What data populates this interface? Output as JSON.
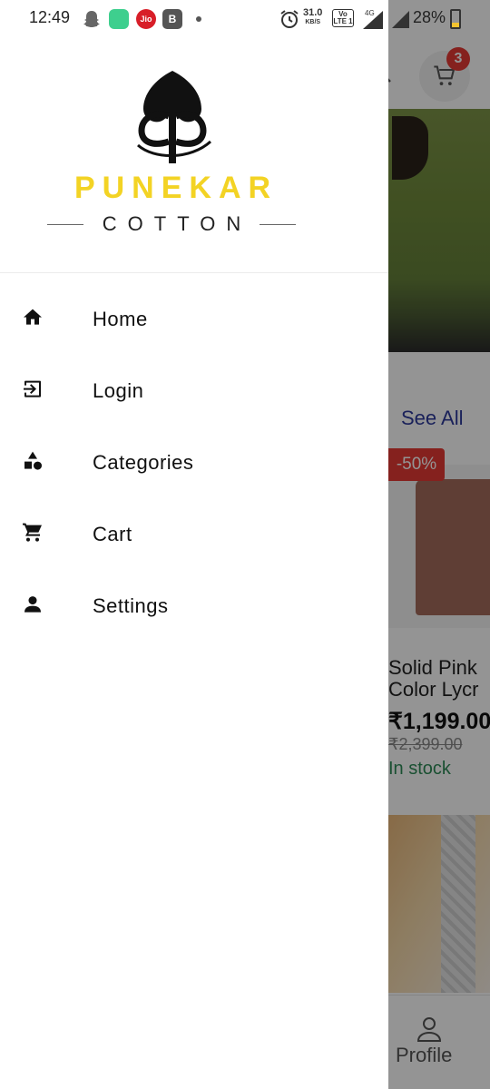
{
  "status_bar": {
    "time": "12:49",
    "jio_label": "Jio",
    "b_label": "B",
    "speed_value": "31.0",
    "speed_unit": "KB/S",
    "volte": "Vo LTE 1",
    "network": "4G",
    "battery": "28%"
  },
  "drawer": {
    "brand_name": "PUNEKAR",
    "brand_sub": "COTTON",
    "menu": [
      {
        "label": "Home",
        "icon": "home-icon"
      },
      {
        "label": "Login",
        "icon": "login-icon"
      },
      {
        "label": "Categories",
        "icon": "categories-icon"
      },
      {
        "label": "Cart",
        "icon": "cart-icon"
      },
      {
        "label": "Settings",
        "icon": "person-icon"
      }
    ]
  },
  "background": {
    "cart_badge": "3",
    "see_all": "See All",
    "discount_badge": "-50%",
    "product_name_line1": "Solid Pink",
    "product_name_line2": "Color Lycr",
    "price": "₹1,199.00",
    "mrp": "₹2,399.00",
    "stock": "In stock",
    "nav_profile": "Profile"
  },
  "colors": {
    "brand_yellow": "#f3d324",
    "badge_red": "#e53935",
    "link_blue": "#2d3a9c",
    "stock_green": "#2e8b57"
  }
}
